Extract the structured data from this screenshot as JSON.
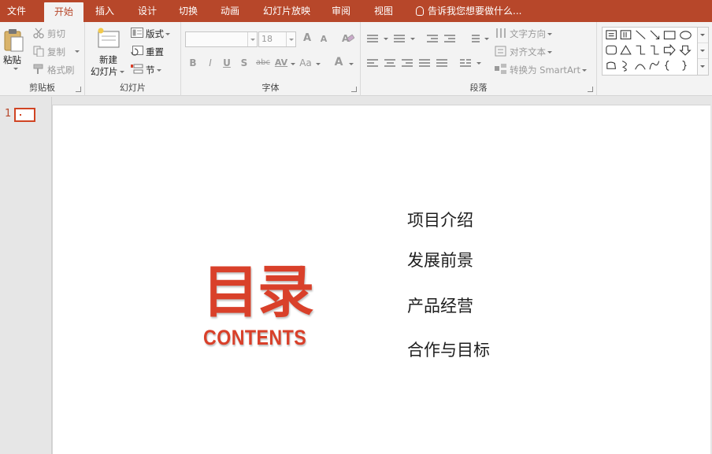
{
  "tabs": [
    {
      "label": "文件",
      "active": false
    },
    {
      "label": "开始",
      "active": true
    },
    {
      "label": "插入",
      "active": false
    },
    {
      "label": "设计",
      "active": false
    },
    {
      "label": "切换",
      "active": false
    },
    {
      "label": "动画",
      "active": false
    },
    {
      "label": "幻灯片放映",
      "active": false
    },
    {
      "label": "审阅",
      "active": false
    },
    {
      "label": "视图",
      "active": false
    }
  ],
  "tell_me": "告诉我您想要做什么...",
  "ribbon": {
    "clipboard": {
      "label": "剪贴板",
      "paste": "粘贴",
      "cut": "剪切",
      "copy": "复制",
      "format_painter": "格式刷"
    },
    "slides": {
      "label": "幻灯片",
      "new_slide_line1": "新建",
      "new_slide_line2": "幻灯片",
      "layout": "版式",
      "reset": "重置",
      "section": "节"
    },
    "font": {
      "label": "字体",
      "font_name": "",
      "font_size": "18",
      "grow": "A",
      "shrink": "A",
      "bold": "B",
      "italic": "I",
      "underline": "U",
      "shadow": "S",
      "strike": "abc",
      "spacing": "AV",
      "change_case": "Aa",
      "font_color": "A"
    },
    "paragraph": {
      "label": "段落",
      "text_direction": "文字方向",
      "align_text": "对齐文本",
      "convert_smartart": "转换为 SmartArt"
    }
  },
  "slide_panel": {
    "slide_number": "1"
  },
  "slide": {
    "title": "目录",
    "subtitle": "CONTENTS",
    "items": [
      "项目介绍",
      "发展前景",
      "产品经营",
      "合作与目标"
    ]
  },
  "colors": {
    "accent": "#b7472a",
    "title_red": "#d9402a"
  }
}
